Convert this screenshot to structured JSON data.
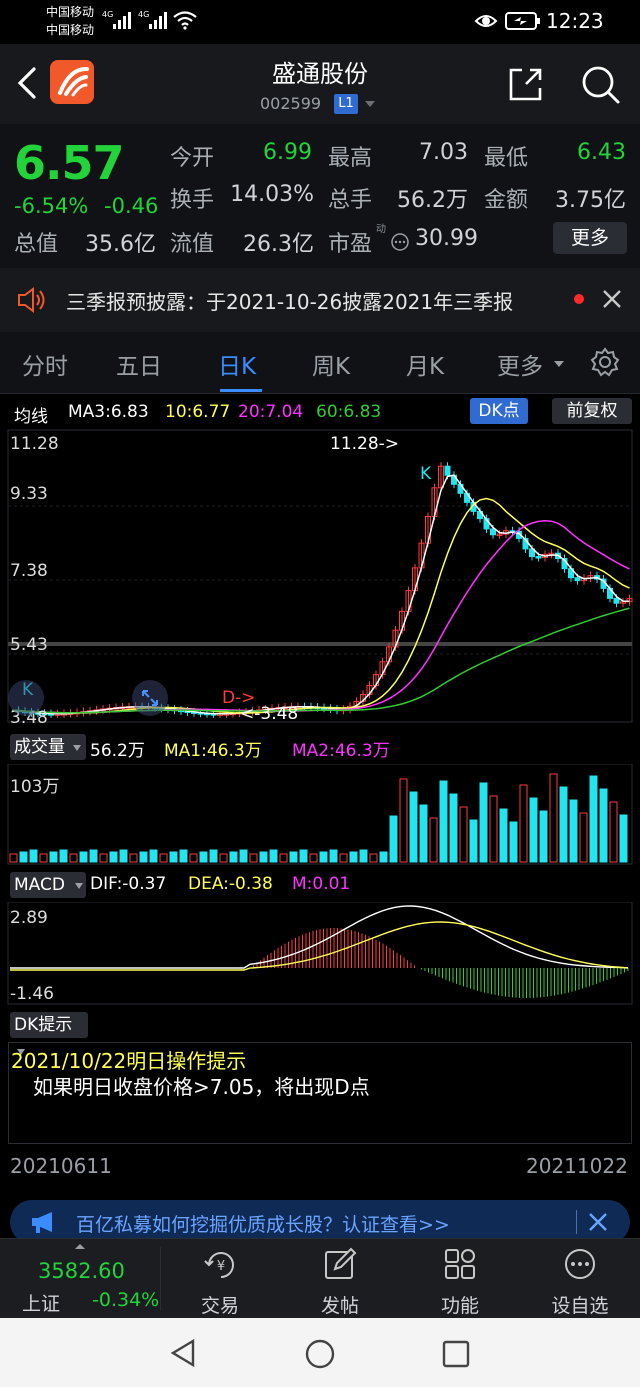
{
  "status_bar": {
    "carrier1": "中国移动",
    "carrier2": "中国移动",
    "signal1": "4G",
    "signal2": "4G",
    "time": "12:23"
  },
  "header": {
    "title": "盛通股份",
    "code": "002599",
    "badge": "L1"
  },
  "quote": {
    "price": "6.57",
    "change_pct": "-6.54%",
    "change_abs": "-0.46",
    "open_label": "今开",
    "open_value": "6.99",
    "high_label": "最高",
    "high_value": "7.03",
    "low_label": "最低",
    "low_value": "6.43",
    "turnover_label": "换手",
    "turnover_value": "14.03%",
    "volume_label": "总手",
    "volume_value": "56.2万",
    "amount_label": "金额",
    "amount_value": "3.75亿",
    "mcap_label": "总值",
    "mcap_value": "35.6亿",
    "float_label": "流值",
    "float_value": "26.3亿",
    "pe_label": "市盈",
    "pe_sup": "动",
    "pe_value": "30.99",
    "more_label": "更多"
  },
  "notice": {
    "text": "三季报预披露：于2021-10-26披露2021年三季报"
  },
  "tabs": [
    "分时",
    "五日",
    "日K",
    "周K",
    "月K",
    "更多"
  ],
  "active_tab": "日K",
  "kline": {
    "ma_title": "均线",
    "ma3": "MA3:6.83",
    "ma10": "10:6.77",
    "ma20": "20:7.04",
    "ma60": "60:6.83",
    "dk_button": "DK点",
    "adjust_button": "前复权",
    "y_labels": [
      "11.28",
      "9.33",
      "7.38",
      "5.43",
      "3.48"
    ],
    "high_marker": "11.28->",
    "low_marker": "<-3.48",
    "k_marker": "K",
    "d_marker": "D->",
    "colors": {
      "ma3": "#ffffff",
      "ma10": "#ffff55",
      "ma20": "#ff33ff",
      "ma60": "#33cc33",
      "up": "#ff3b3b",
      "down": "#22e5f0"
    }
  },
  "volume": {
    "dropdown_label": "成交量",
    "value": "56.2万",
    "ma1": "MA1:46.3万",
    "ma2": "MA2:46.3万",
    "y_label": "103万"
  },
  "macd": {
    "dropdown_label": "MACD",
    "dif": "DIF:-0.37",
    "dea": "DEA:-0.38",
    "m": "M:0.01",
    "y_top": "2.89",
    "y_bottom": "-1.46"
  },
  "dk_tip": {
    "dropdown_label": "DK提示",
    "title": "2021/10/22明日操作提示",
    "body": "如果明日收盘价格>7.05，将出现D点"
  },
  "date_range": {
    "start": "20210611",
    "end": "20211022"
  },
  "ad": {
    "text": "百亿私募如何挖掘优质成长股？认证查看>>"
  },
  "bottom_nav": {
    "index_value": "3582.60",
    "index_name": "上证",
    "index_change": "-0.34%",
    "items": [
      "交易",
      "发帖",
      "功能",
      "设自选"
    ]
  }
}
